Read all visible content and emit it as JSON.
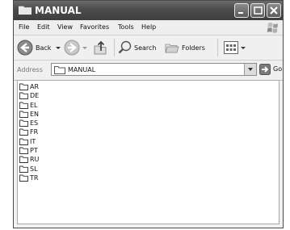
{
  "window": {
    "title": "MANUAL"
  },
  "menubar": {
    "items": [
      {
        "label": "File"
      },
      {
        "label": "Edit"
      },
      {
        "label": "View"
      },
      {
        "label": "Favorites"
      },
      {
        "label": "Tools"
      },
      {
        "label": "Help"
      }
    ]
  },
  "toolbar": {
    "back_label": "Back",
    "search_label": "Search",
    "folders_label": "Folders"
  },
  "addressbar": {
    "label": "Address",
    "value": "MANUAL",
    "go_label": "Go"
  },
  "files": [
    {
      "name": "AR"
    },
    {
      "name": "DE"
    },
    {
      "name": "EL"
    },
    {
      "name": "EN"
    },
    {
      "name": "ES"
    },
    {
      "name": "FR"
    },
    {
      "name": "IT"
    },
    {
      "name": "PT"
    },
    {
      "name": "RU"
    },
    {
      "name": "SL"
    },
    {
      "name": "TR"
    }
  ],
  "colors": {
    "titlebar": "#4d4d4d",
    "window_bg": "#f0f0f0",
    "content_bg": "#ffffff"
  }
}
